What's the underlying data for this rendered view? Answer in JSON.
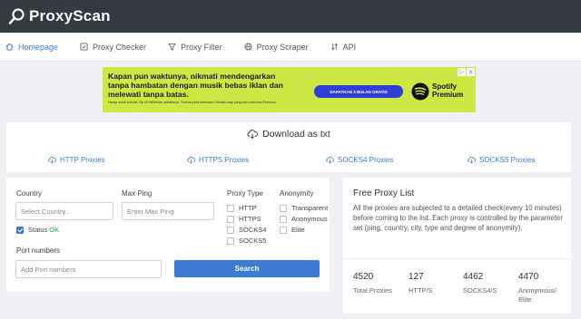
{
  "brand": {
    "name": "ProxyScan"
  },
  "nav": {
    "items": [
      {
        "label": "Homepage",
        "icon": "home-icon",
        "active": true
      },
      {
        "label": "Proxy Checker",
        "icon": "checkbox-icon"
      },
      {
        "label": "Proxy Filter",
        "icon": "filter-icon"
      },
      {
        "label": "Proxy Scraper",
        "icon": "globe-icon"
      },
      {
        "label": "API",
        "icon": "api-icon"
      }
    ]
  },
  "ad": {
    "headline": "Kapan pun waktunya, nikmati mendengarkan tanpa hambatan dengan musik bebas iklan dan melewati tanpa batas.",
    "fine_print": "Hanya untuk individu. Rp 49.990/bulan setelahnya. Tunduk pada ketentuan. Berlaku bagi yang baru mencoba Premium.",
    "cta": "DAPATKAN 3 BULAN GRATIS",
    "brand_line1": "Spotify",
    "brand_line2": "Premium",
    "bg_color": "#cde842"
  },
  "download": {
    "title": "Download as txt",
    "links": [
      "HTTP Proxies",
      "HTTPS Proxies",
      "SOCKS4 Proxies",
      "SOCKS5 Proxies"
    ]
  },
  "filter": {
    "country_label": "Country",
    "country_placeholder": "Select Country...",
    "status_label": "Status",
    "status_value": "OK",
    "maxping_label": "Max Ping",
    "maxping_placeholder": "Enter Max Ping",
    "ports_label": "Port numbers",
    "ports_placeholder": "Add Port numbers",
    "proxy_type_label": "Proxy Type",
    "proxy_types": [
      "HTTP",
      "HTTPS",
      "SOCKS4",
      "SOCKS5"
    ],
    "anonymity_label": "Anonymity",
    "anonymity_options": [
      "Transparent",
      "Anonymous",
      "Elite"
    ],
    "search_label": "Search"
  },
  "info": {
    "title": "Free Proxy List",
    "description": "All the proxies are subjected to a detailed check(every 10 minutes) before coming to the list. Each proxy is controlled by the parameter set (ping, country, city, type and degree of anonymity).",
    "stats": [
      {
        "value": "4520",
        "label": "Total Proxies"
      },
      {
        "value": "127",
        "label": "HTTP/S"
      },
      {
        "value": "4462",
        "label": "SOCKS4/S"
      },
      {
        "value": "4470",
        "label": "Anonymous/ Elite"
      }
    ]
  },
  "colors": {
    "accent": "#3d7ad6",
    "topbar": "#343a40",
    "ok": "#1e9e45"
  }
}
